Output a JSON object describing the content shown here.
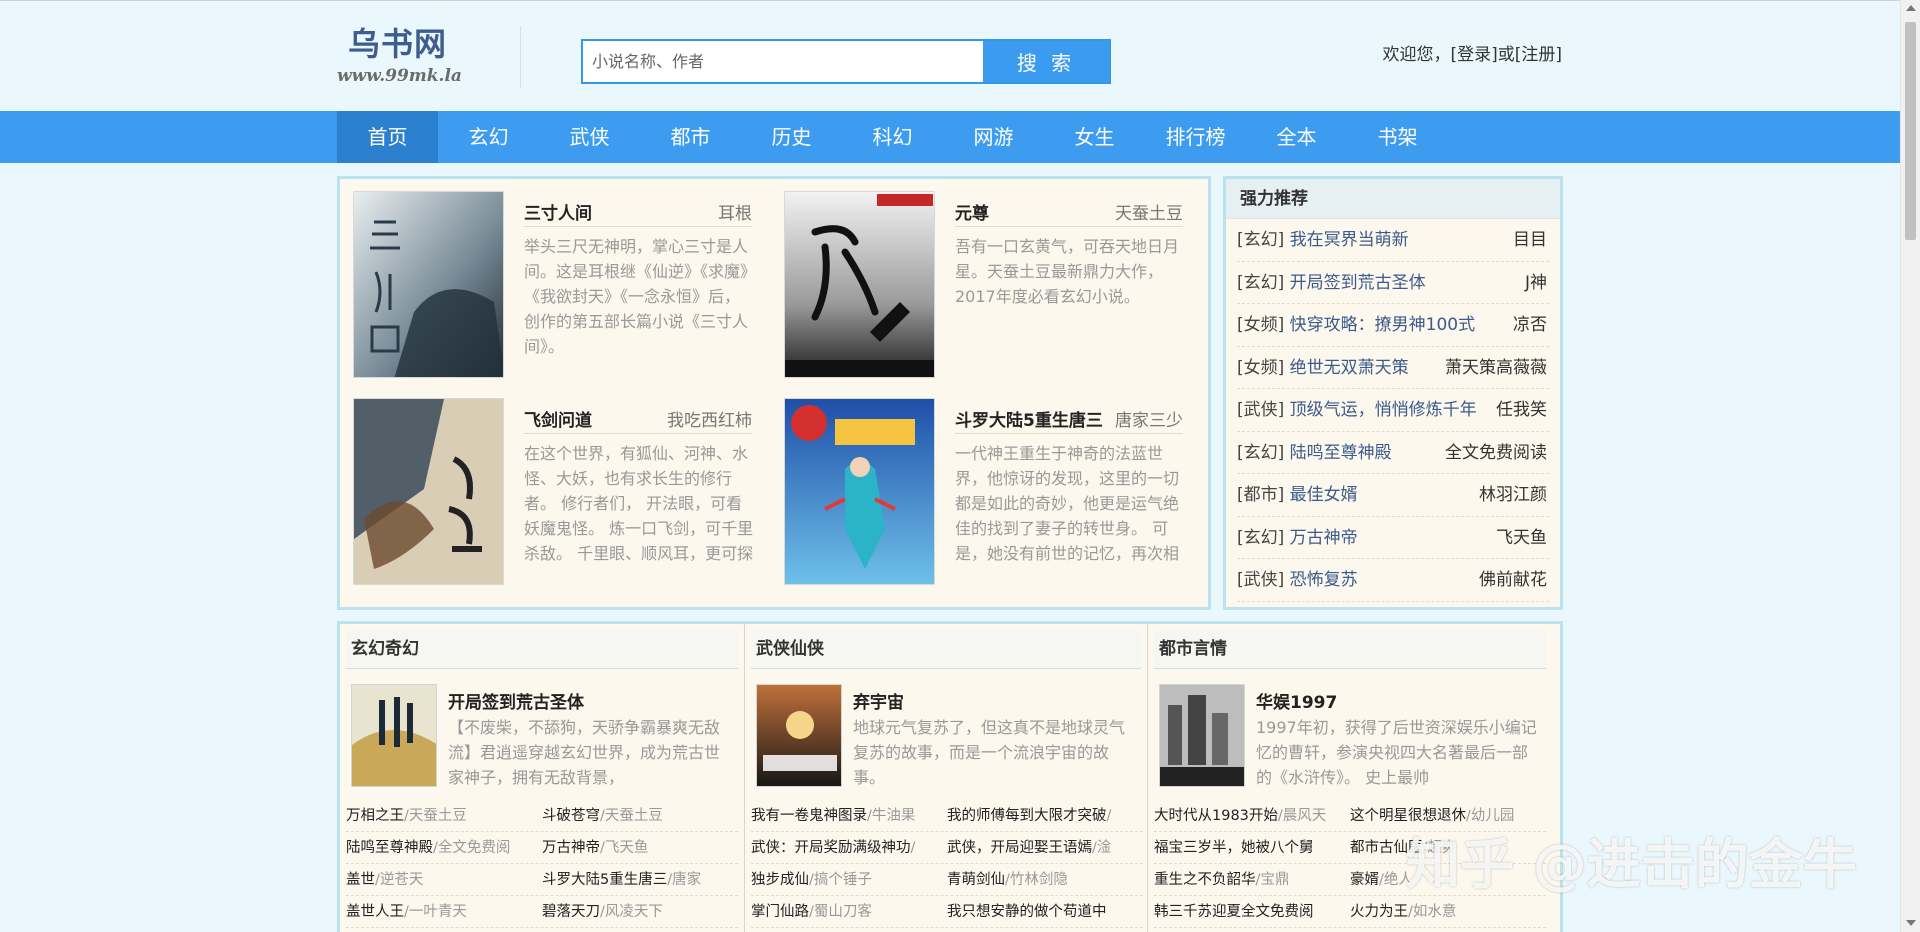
{
  "site": {
    "name": "乌书网",
    "url": "www.99mk.la"
  },
  "search": {
    "placeholder": "小说名称、作者",
    "button": "搜 索"
  },
  "user": {
    "welcome": "欢迎您，",
    "login": "[登录]",
    "or": "或",
    "register": "[注册]"
  },
  "nav": [
    "首页",
    "玄幻",
    "武侠",
    "都市",
    "历史",
    "科幻",
    "网游",
    "女生",
    "排行榜",
    "全本",
    "书架"
  ],
  "featured": [
    {
      "title": "三寸人间",
      "author": "耳根",
      "desc": "举头三尺无神明，掌心三寸是人间。这是耳根继《仙逆》《求魔》《我欲封天》《一念永恒》后，创作的第五部长篇小说《三寸人间》。"
    },
    {
      "title": "元尊",
      "author": "天蚕土豆",
      "desc": "吾有一口玄黄气，可吞天地日月星。天蚕土豆最新鼎力大作，2017年度必看玄幻小说。"
    },
    {
      "title": "飞剑问道",
      "author": "我吃西红柿",
      "desc": "在这个世界，有狐仙、河神、水怪、大妖，也有求长生的修行者。 修行者们， 开法眼，可看妖魔鬼怪。 炼一口飞剑，可千里杀敌。 千里眼、顺风耳，更可探查四方。 ……"
    },
    {
      "title": "斗罗大陆5重生唐三",
      "author": "唐家三少",
      "desc": "一代神王重生于神奇的法蓝世界，他惊讶的发现，这里的一切都是如此的奇妙，他更是运气绝佳的找到了妻子的转世身。 可是，她没有前世的记忆，再次相遇已是路人。一代"
    }
  ],
  "recommend": {
    "heading": "强力推荐",
    "items": [
      {
        "cat": "[玄幻]",
        "name": "我在冥界当萌新",
        "author": "目目"
      },
      {
        "cat": "[玄幻]",
        "name": "开局签到荒古圣体",
        "author": "J神"
      },
      {
        "cat": "[女频]",
        "name": "快穿攻略：撩男神100式",
        "author": "凉否"
      },
      {
        "cat": "[女频]",
        "name": "绝世无双萧天策",
        "author": "萧天策高薇薇"
      },
      {
        "cat": "[武侠]",
        "name": "顶级气运，悄悄修炼千年",
        "author": "任我笑"
      },
      {
        "cat": "[玄幻]",
        "name": "陆鸣至尊神殿",
        "author": "全文免费阅读"
      },
      {
        "cat": "[都市]",
        "name": "最佳女婿",
        "author": "林羽江颜"
      },
      {
        "cat": "[玄幻]",
        "name": "万古神帝",
        "author": "飞天鱼"
      },
      {
        "cat": "[武侠]",
        "name": "恐怖复苏",
        "author": "佛前献花"
      }
    ]
  },
  "categories": [
    {
      "heading": "玄幻奇幻",
      "top": {
        "title": "开局签到荒古圣体",
        "desc": "【不废柴，不舔狗，天骄争霸暴爽无敌流】君逍遥穿越玄幻世界，成为荒古世家神子，拥有无敌背景，"
      },
      "rows": [
        [
          {
            "t": "万相之王",
            "a": "/天蚕土豆"
          },
          {
            "t": "斗破苍穹",
            "a": "/天蚕土豆"
          }
        ],
        [
          {
            "t": "陆鸣至尊神殿",
            "a": "/全文免费阅"
          },
          {
            "t": "万古神帝",
            "a": "/飞天鱼"
          }
        ],
        [
          {
            "t": "盖世",
            "a": "/逆苍天"
          },
          {
            "t": "斗罗大陆5重生唐三",
            "a": "/唐家"
          }
        ],
        [
          {
            "t": "盖世人王",
            "a": "/一叶青天"
          },
          {
            "t": "碧落天刀",
            "a": "/风凌天下"
          }
        ]
      ]
    },
    {
      "heading": "武侠仙侠",
      "top": {
        "title": "弃宇宙",
        "desc": "地球元气复苏了，但这真不是地球灵气复苏的故事，而是一个流浪宇宙的故事。"
      },
      "rows": [
        [
          {
            "t": "我有一卷鬼神图录",
            "a": "/牛油果"
          },
          {
            "t": "我的师傅每到大限才突破",
            "a": "/"
          }
        ],
        [
          {
            "t": "武侠：开局奖励满级神功",
            "a": "/"
          },
          {
            "t": "武侠，开局迎娶王语嫣",
            "a": "/淦"
          }
        ],
        [
          {
            "t": "独步成仙",
            "a": "/搞个锤子"
          },
          {
            "t": "青萌剑仙",
            "a": "/竹林剑隐"
          }
        ],
        [
          {
            "t": "掌门仙路",
            "a": "/蜀山刀客"
          },
          {
            "t": "我只想安静的做个苟道中",
            "a": ""
          }
        ]
      ]
    },
    {
      "heading": "都市言情",
      "top": {
        "title": "华娱1997",
        "desc": "1997年初，获得了后世资深娱乐小编记忆的曹轩，参演央视四大名著最后一部的《水浒传》。 史上最帅"
      },
      "rows": [
        [
          {
            "t": "大时代从1983开始",
            "a": "/晨风天"
          },
          {
            "t": "这个明星很想退休",
            "a": "/幼儿园"
          }
        ],
        [
          {
            "t": "福宝三岁半，她被八个舅",
            "a": ""
          },
          {
            "t": "都市古仙医",
            "a": "/超爽"
          }
        ],
        [
          {
            "t": "重生之不负韶华",
            "a": "/宝鼎"
          },
          {
            "t": "豪婿",
            "a": "/绝人"
          }
        ],
        [
          {
            "t": "韩三千苏迎夏全文免费阅",
            "a": ""
          },
          {
            "t": "火力为王",
            "a": "/如水意"
          }
        ]
      ]
    }
  ],
  "watermark": "知乎 @进击的金牛"
}
